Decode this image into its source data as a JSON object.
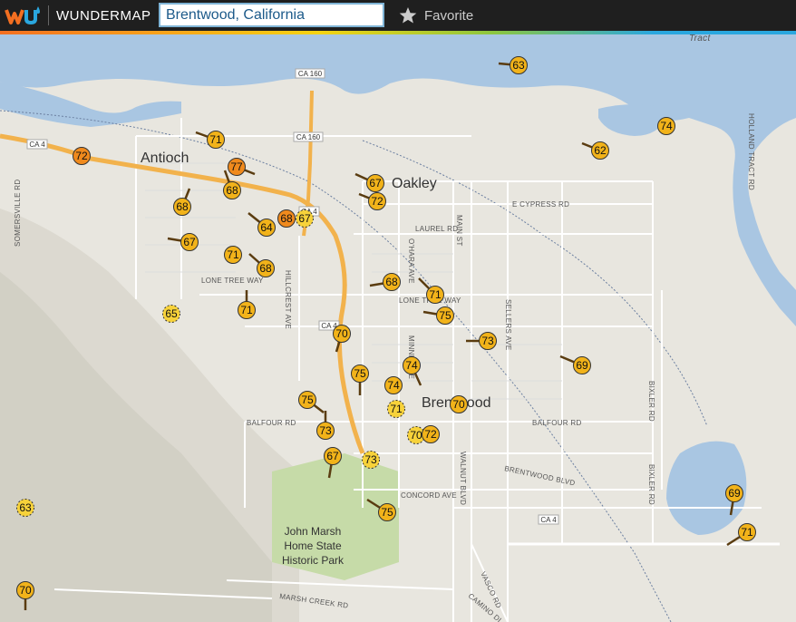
{
  "header": {
    "brand": "WUNDERMAP",
    "logo_icon": "wu-logo-icon",
    "search_value": "Brentwood, California",
    "favorite_label": "Favorite",
    "favorite_icon": "star-icon",
    "colors": {
      "bar": "#1f1f1f",
      "search_text": "#1c5a8a"
    }
  },
  "map": {
    "cities": [
      "Antioch",
      "Oakley",
      "Brentwood"
    ],
    "park": [
      "John Marsh",
      "Home State",
      "Historic Park"
    ],
    "roads": [
      "CA 4",
      "CA 160",
      "CA 160",
      "CA 4",
      "CA 4",
      "CA 4",
      "E CYPRESS RD",
      "LAUREL RD",
      "LONE TREE WAY",
      "LONE TREE WAY",
      "BALFOUR RD",
      "BALFOUR RD",
      "BRENTWOOD BLVD",
      "CONCORD AVE",
      "MARSH CREEK RD",
      "CAMINO DI...",
      "VASCO RD",
      "WALNUT BLVD",
      "SELLERS AVE",
      "BIXLER RD",
      "BIXLER RD",
      "HOLLAND TRACT RD",
      "MAIN ST",
      "O'HARA AVE",
      "MINNIE AVE",
      "HILLCREST AVE",
      "SOMERSVILLE RD",
      "Tract"
    ],
    "stations": [
      "63",
      "74",
      "62",
      "71",
      "72",
      "77",
      "68",
      "67",
      "72",
      "68",
      "64",
      "68",
      "67",
      "67",
      "71",
      "68",
      "68",
      "71",
      "71",
      "75",
      "65",
      "70",
      "73",
      "69",
      "75",
      "74",
      "74",
      "70",
      "71",
      "75",
      "73",
      "70",
      "72",
      "67",
      "73",
      "75",
      "63",
      "69",
      "71",
      "70"
    ],
    "colors": {
      "water": "#a9c6e2",
      "land": "#e6e4de",
      "park": "#c6dba8",
      "freeway": "#f2b24c",
      "pin": "#f2b31a",
      "pin_alt": "#f08a1d",
      "pin_dashed": "#f7d23a"
    }
  }
}
